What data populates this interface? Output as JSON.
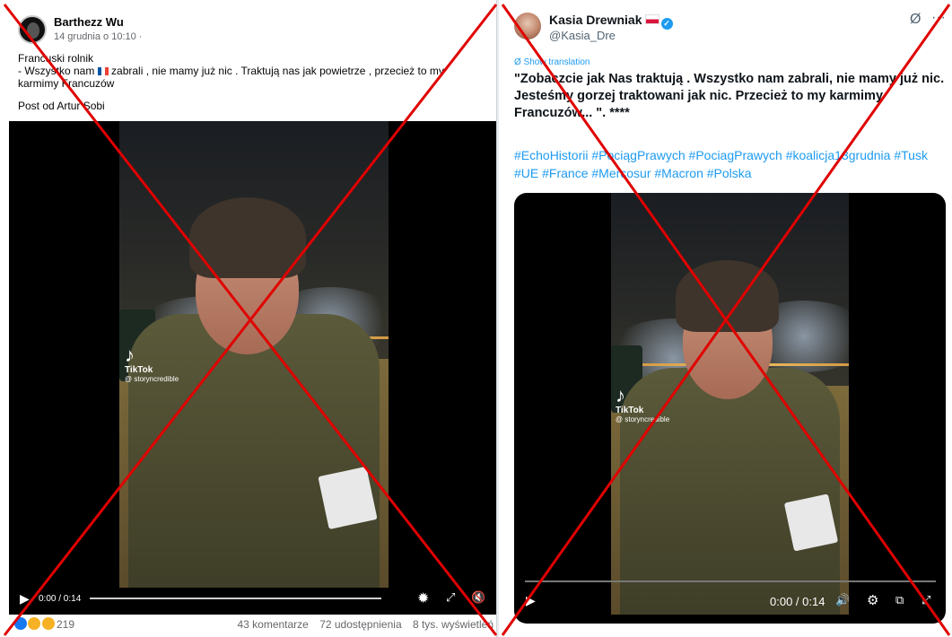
{
  "facebook": {
    "author": "Barthezz Wu",
    "timestamp": "14 grudnia o 10:10 ·",
    "text_line1": "Francuski rolnik",
    "text_line2_a": "- Wszystko nam",
    "text_line2_b": "zabrali , nie mamy już nic . Traktują nas jak powietrze , przecież to my karmimy Francuzów",
    "source": "Post od Artur Sobi",
    "video": {
      "watermark_name": "TikTok",
      "watermark_user": "@ storyncredible",
      "time": "0:00 / 0:14",
      "play_icon": "▶",
      "settings_icon": "✹",
      "fullscreen_icon": "⤢",
      "mute_icon": "🔇"
    },
    "reaction_count": "219",
    "comments": "43 komentarze",
    "shares": "72 udostępnienia",
    "views": "8 tys. wyświetleń"
  },
  "twitter": {
    "name": "Kasia Drewniak",
    "handle": "@Kasia_Dre",
    "verified_icon": "✓",
    "grok_icon": "Ø",
    "more_icon": "···",
    "translate": "Show translation",
    "text": "\"Zobaczcie jak Nas traktują . Wszystko nam zabrali, nie mamy już nic. Jesteśmy gorzej traktowani jak nic. Przecież to my karmimy Francuzów... \". ****",
    "hashtags": "#EchoHistorii #PociągPrawych #PociagPrawych #koalicja13grudnia #Tusk #UE #France #Mercosur #Macron #Polska",
    "video": {
      "watermark_name": "TikTok",
      "watermark_user": "@ storyncredible",
      "time": "0:00 / 0:14",
      "play_icon": "▶",
      "volume_icon": "🔊",
      "settings_icon": "⚙",
      "pip_icon": "⧉",
      "fullscreen_icon": "⤢"
    }
  },
  "overlay": {
    "cross_color": "#e00000"
  }
}
